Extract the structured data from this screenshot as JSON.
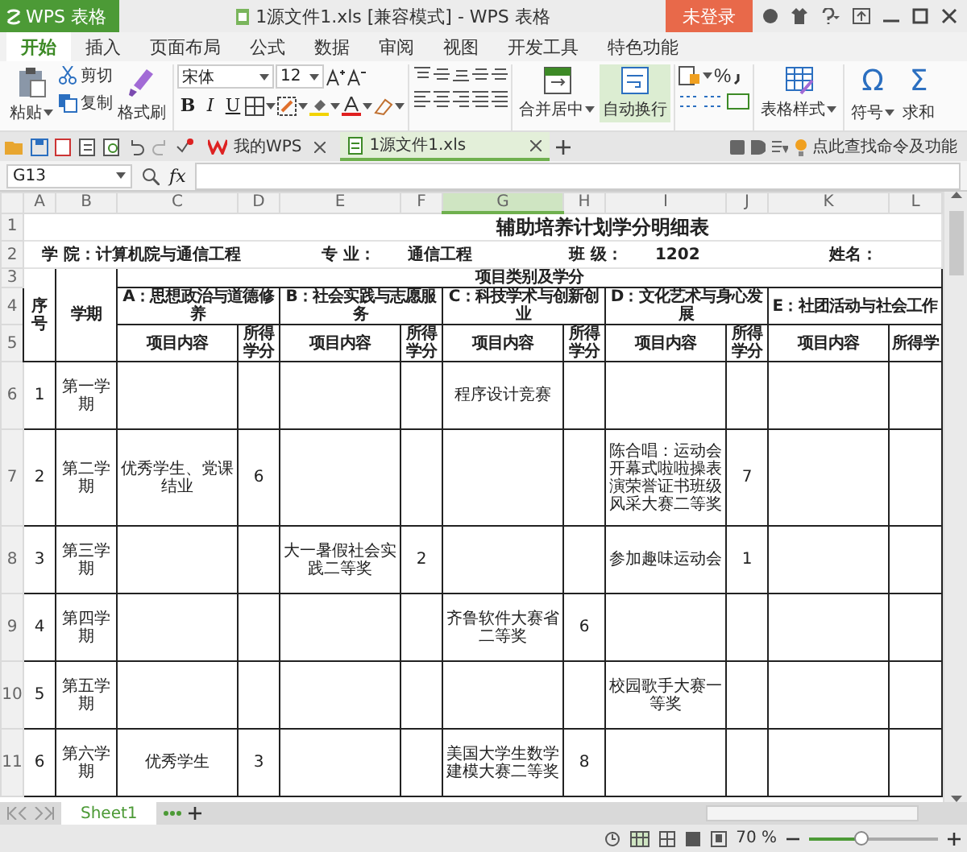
{
  "window": {
    "app_button": "WPS 表格",
    "title": "1源文件1.xls [兼容模式] - WPS 表格",
    "login_button": "未登录"
  },
  "menu_tabs": [
    {
      "label": "开始",
      "selected": true
    },
    {
      "label": "插入",
      "selected": false
    },
    {
      "label": "页面布局",
      "selected": false
    },
    {
      "label": "公式",
      "selected": false
    },
    {
      "label": "数据",
      "selected": false
    },
    {
      "label": "审阅",
      "selected": false
    },
    {
      "label": "视图",
      "selected": false
    },
    {
      "label": "开发工具",
      "selected": false
    },
    {
      "label": "特色功能",
      "selected": false
    }
  ],
  "ribbon": {
    "paste": "粘贴",
    "cut": "剪切",
    "copy": "复制",
    "format_painter": "格式刷",
    "font_name": "宋体",
    "font_size": "12",
    "bold": "B",
    "italic": "I",
    "underline": "U",
    "merge": "合并居中",
    "wrap": {
      "label": "自动换行",
      "on": true
    },
    "percent": "%",
    "table_style": "表格样式",
    "symbol_glyph": "Ω",
    "symbol": "符号",
    "sum_glyph": "Σ",
    "sum": "求和"
  },
  "doc_tabs": [
    {
      "label": "我的WPS",
      "selected": false
    },
    {
      "label": "1源文件1.xls",
      "selected": true
    }
  ],
  "search_hint": "点此查找命令及功能",
  "formula_bar": {
    "cell_ref": "G13",
    "fx": "fx"
  },
  "sheet": {
    "columns": [
      {
        "label": "A",
        "selected": false
      },
      {
        "label": "B",
        "selected": false
      },
      {
        "label": "C",
        "selected": false
      },
      {
        "label": "D",
        "selected": false
      },
      {
        "label": "E",
        "selected": false
      },
      {
        "label": "F",
        "selected": false
      },
      {
        "label": "G",
        "selected": true
      },
      {
        "label": "H",
        "selected": false
      },
      {
        "label": "I",
        "selected": false
      },
      {
        "label": "J",
        "selected": false
      },
      {
        "label": "K",
        "selected": false
      },
      {
        "label": "L",
        "selected": false
      }
    ],
    "row_numbers": [
      "1",
      "2",
      "3",
      "4",
      "5",
      "6",
      "7",
      "8",
      "9",
      "10",
      "11"
    ],
    "title": "辅助培养计划学分明细表",
    "info": [
      "学 院：计算机院与通信工程",
      "专 业：",
      "通信工程",
      "班 级：",
      "1202",
      "姓名："
    ],
    "col_no": "序号",
    "col_term": "学期",
    "group_header": "项目类别及学分",
    "categories": [
      "A：思想政治与道德修养",
      "B：社会实践与志愿服务",
      "C：科技学术与创新创业",
      "D：文化艺术与身心发展",
      "E：社团活动与社会工作"
    ],
    "subheaders": [
      "项目内容",
      "所得学分",
      "项目内容",
      "所得学分",
      "项目内容",
      "所得学分",
      "项目内容",
      "所得学分",
      "项目内容",
      "所得学"
    ],
    "rows": [
      {
        "no": "1",
        "term": "第一学期",
        "cells": {
          "G": "程序设计竞赛"
        }
      },
      {
        "no": "2",
        "term": "第二学期",
        "cells": {
          "C": "优秀学生、党课结业",
          "D": "6",
          "I": "陈合唱：运动会开幕式啦啦操表演荣誉证书班级风采大赛二等奖",
          "J": "7"
        }
      },
      {
        "no": "3",
        "term": "第三学期",
        "cells": {
          "E": "大一暑假社会实践二等奖",
          "F": "2",
          "I": "参加趣味运动会",
          "J": "1"
        }
      },
      {
        "no": "4",
        "term": "第四学期",
        "cells": {
          "G": "齐鲁软件大赛省二等奖",
          "H": "6"
        }
      },
      {
        "no": "5",
        "term": "第五学期",
        "cells": {
          "I": "校园歌手大赛一等奖"
        }
      },
      {
        "no": "6",
        "term": "第六学期",
        "cells": {
          "C": "优秀学生",
          "D": "3",
          "G": "美国大学生数学建模大赛二等奖",
          "H": "8"
        }
      }
    ]
  },
  "sheet_tabs": [
    {
      "label": "Sheet1",
      "selected": true
    }
  ],
  "status": {
    "zoom": "70 %",
    "zoom_slider": {
      "level": 0.4
    }
  }
}
